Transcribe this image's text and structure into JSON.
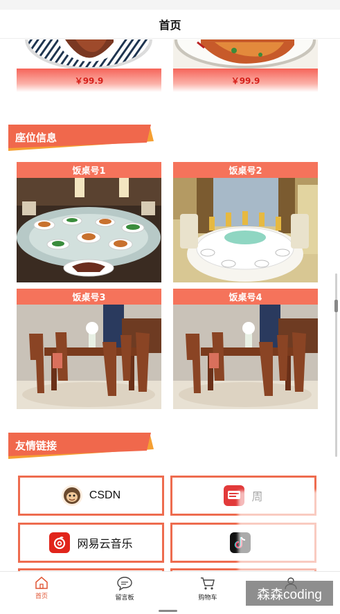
{
  "header": {
    "title": "首页"
  },
  "products": [
    {
      "price": "￥99.9",
      "image_icon": "plate-of-meat-image"
    },
    {
      "price": "￥99.9",
      "image_icon": "plate-of-chicken-image"
    }
  ],
  "sections": {
    "seating": {
      "title": "座位信息"
    },
    "links": {
      "title": "友情链接"
    }
  },
  "tables": [
    {
      "label": "饭桌号1"
    },
    {
      "label": "饭桌号2"
    },
    {
      "label": "饭桌号3"
    },
    {
      "label": "饭桌号4"
    }
  ],
  "friend_links": [
    {
      "label": "CSDN",
      "icon": "csdn-monkey-icon"
    },
    {
      "label": "周",
      "icon": "zhihu-red-icon"
    },
    {
      "label": "网易云音乐",
      "icon": "netease-music-icon"
    },
    {
      "label": "",
      "icon": "tiktok-icon"
    }
  ],
  "tabbar": {
    "items": [
      {
        "label": "首页",
        "icon": "home-icon",
        "active": true
      },
      {
        "label": "留言板",
        "icon": "message-icon",
        "active": false
      },
      {
        "label": "购物车",
        "icon": "cart-icon",
        "active": false
      },
      {
        "label": "",
        "icon": "user-icon",
        "active": false
      }
    ]
  },
  "watermark": {
    "text": "森森coding"
  },
  "colors": {
    "accent": "#f5735b",
    "price": "#d6201a",
    "border": "#ee6c4f",
    "active_tab": "#e05533"
  }
}
